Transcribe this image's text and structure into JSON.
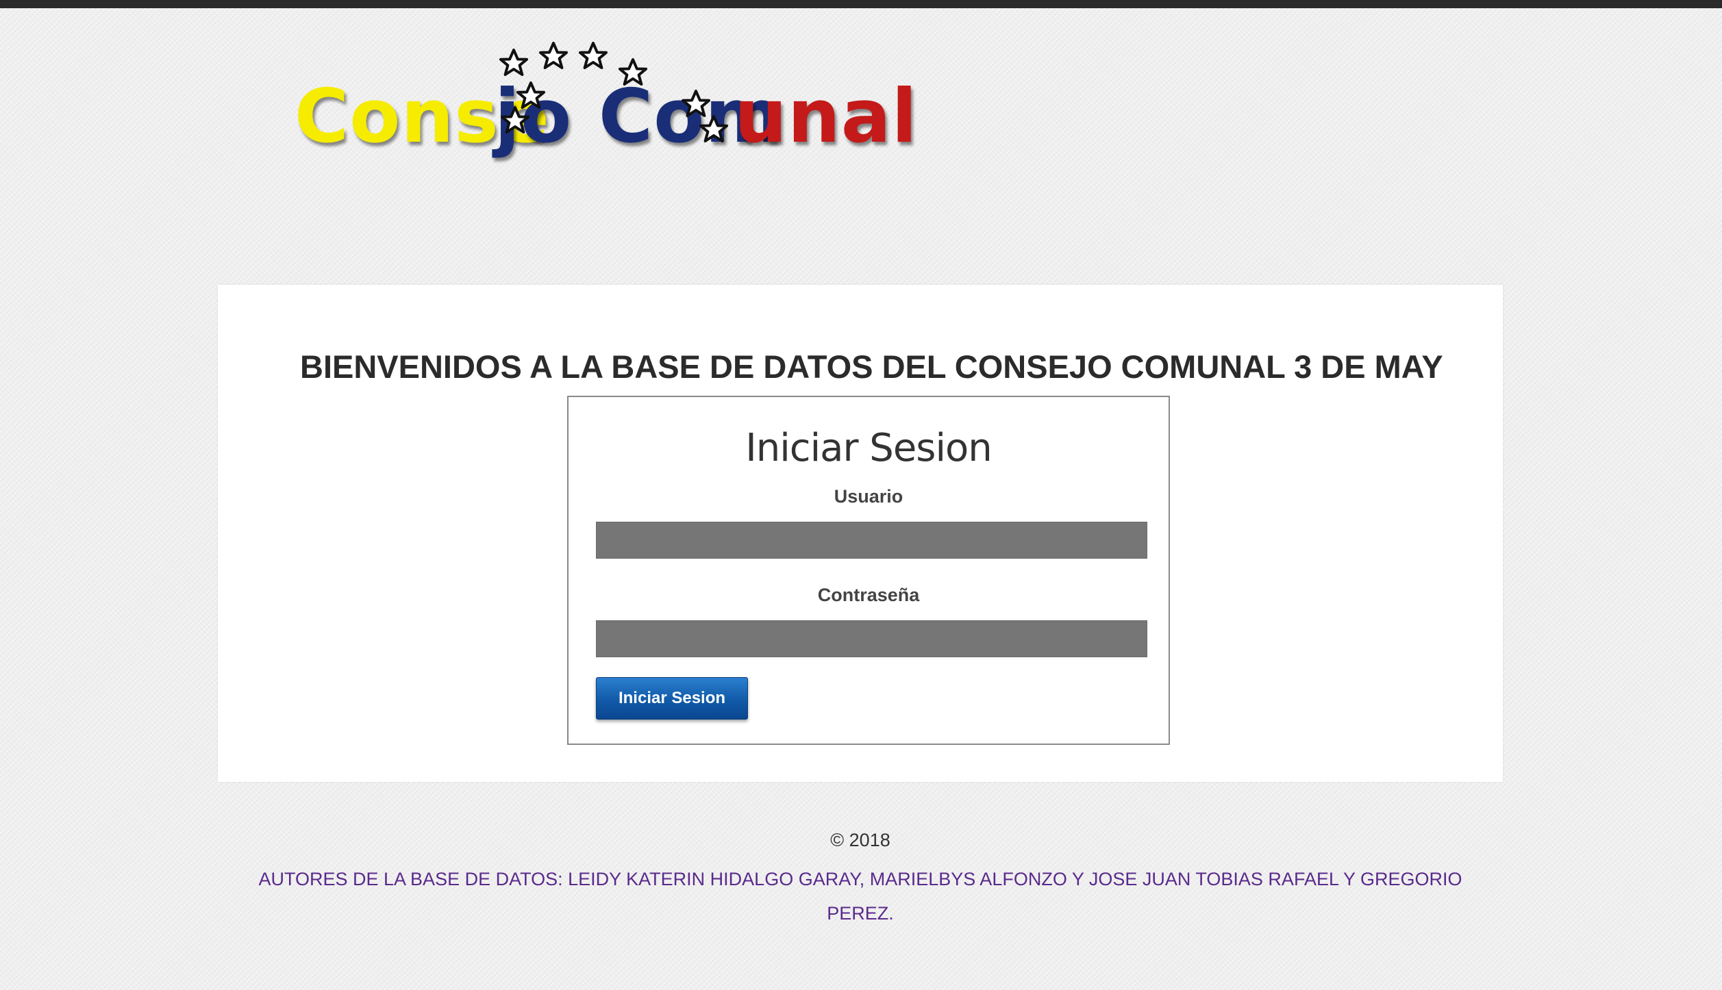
{
  "logo": {
    "part_yellow": "Conse",
    "part_blue": "jo Com",
    "part_red": "unal",
    "star_icon": "star-icon",
    "colors": {
      "yellow": "#f5ec00",
      "blue": "#1a2e78",
      "red": "#c41a1a"
    }
  },
  "panel": {
    "welcome": "BIENVENIDOS A LA BASE DE DATOS DEL CONSEJO COMUNAL 3 DE MAY"
  },
  "login": {
    "title": "Iniciar Sesion",
    "username_label": "Usuario",
    "username_value": "",
    "password_label": "Contraseña",
    "password_value": "",
    "submit_label": "Iniciar Sesion"
  },
  "footer": {
    "copyright": "© 2018",
    "authors": "AUTORES DE LA BASE DE DATOS: LEIDY KATERIN HIDALGO GARAY, MARIELBYS ALFONZO Y JOSE JUAN TOBIAS RAFAEL Y GREGORIO PEREZ."
  },
  "colors": {
    "topbar": "#2a2a2a",
    "button": "#115aa8",
    "input": "#767676",
    "authors_text": "#5a2a8c"
  }
}
